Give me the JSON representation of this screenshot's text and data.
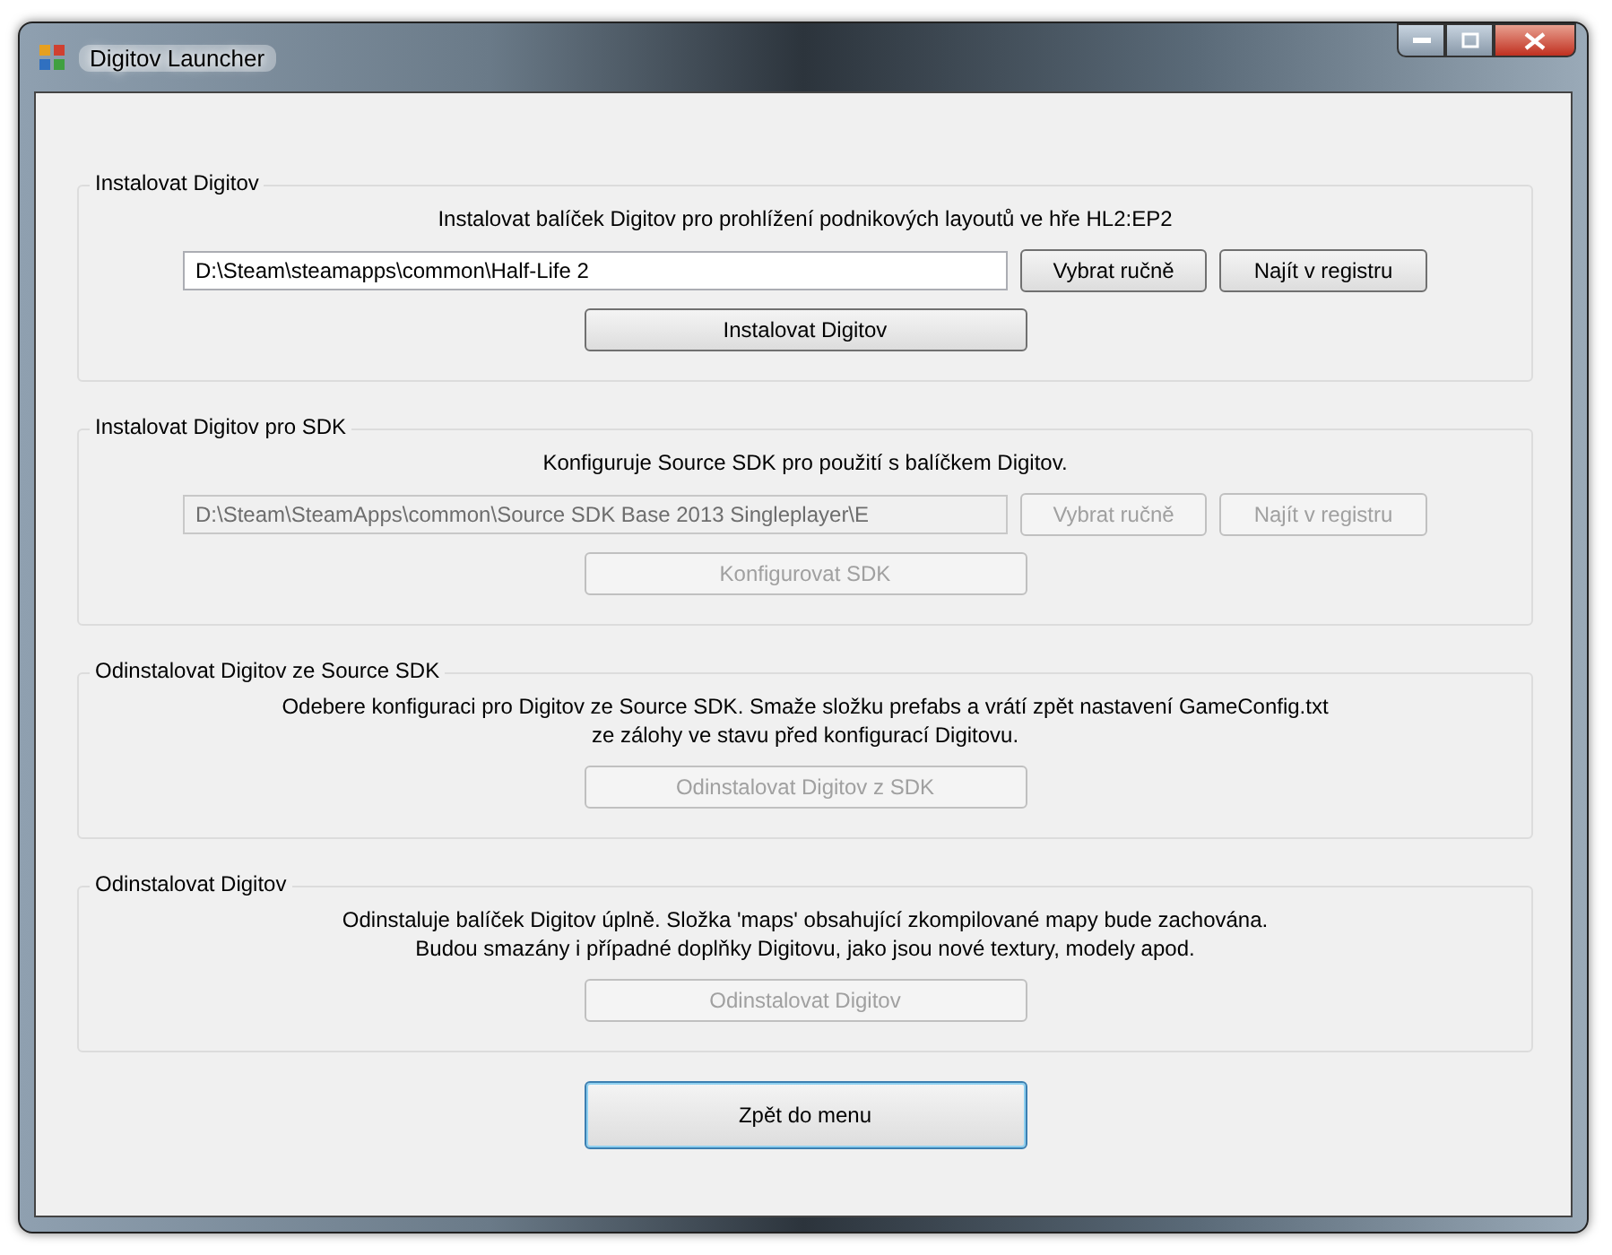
{
  "window": {
    "title": "Digitov Launcher"
  },
  "groups": [
    {
      "title": "Instalovat Digitov",
      "description": "Instalovat balíček Digitov pro prohlížení podnikových layoutů ve hře HL2:EP2",
      "path": {
        "value": "D:\\Steam\\steamapps\\common\\Half-Life 2",
        "disabled": false
      },
      "path_buttons": [
        {
          "label": "Vybrat ručně",
          "disabled": false
        },
        {
          "label": "Najít v registru",
          "disabled": false
        }
      ],
      "action": {
        "label": "Instalovat Digitov",
        "disabled": false
      }
    },
    {
      "title": "Instalovat Digitov pro SDK",
      "description": "Konfiguruje Source SDK pro použití s balíčkem Digitov.",
      "path": {
        "value": "D:\\Steam\\SteamApps\\common\\Source SDK Base 2013 Singleplayer\\E",
        "disabled": true
      },
      "path_buttons": [
        {
          "label": "Vybrat ručně",
          "disabled": true
        },
        {
          "label": "Najít v registru",
          "disabled": true
        }
      ],
      "action": {
        "label": "Konfigurovat SDK",
        "disabled": true
      }
    },
    {
      "title": "Odinstalovat Digitov ze Source SDK",
      "description": "Odebere konfiguraci pro Digitov ze Source SDK. Smaže složku prefabs a vrátí zpět nastavení GameConfig.txt\nze zálohy ve stavu před konfigurací Digitovu.",
      "action": {
        "label": "Odinstalovat Digitov z SDK",
        "disabled": true
      }
    },
    {
      "title": "Odinstalovat Digitov",
      "description": "Odinstaluje balíček Digitov úplně. Složka 'maps' obsahující zkompilované mapy bude zachována.\nBudou smazány i případné doplňky Digitovu, jako jsou nové textury, modely apod.",
      "action": {
        "label": "Odinstalovat Digitov",
        "disabled": true
      }
    }
  ],
  "back_button": {
    "label": "Zpět do menu",
    "default": true
  }
}
